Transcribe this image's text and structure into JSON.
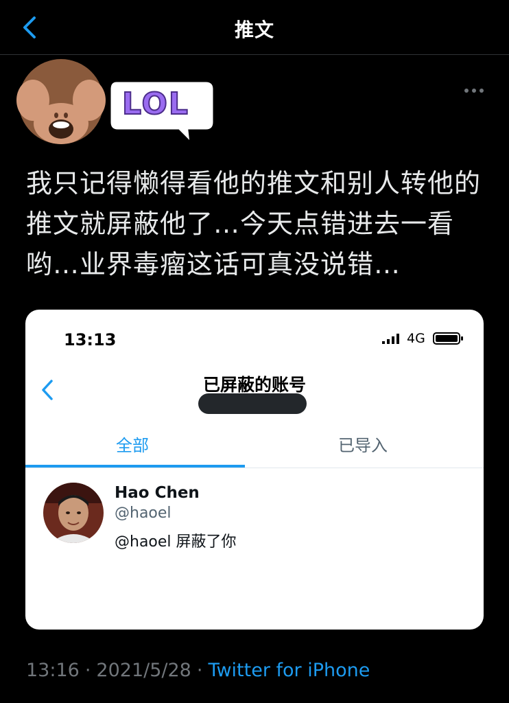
{
  "header": {
    "title": "推文"
  },
  "tweet": {
    "sticker_text": "LOL",
    "text": "我只记得懒得看他的推文和别人转他的推文就屏蔽他了…今天点错进去一看哟…业界毒瘤这话可真没说错…",
    "timestamp_time": "13:16",
    "timestamp_date": "2021/5/28",
    "separator": "·",
    "source": "Twitter for iPhone"
  },
  "embedded_screenshot": {
    "status_time": "13:13",
    "network": "4G",
    "title": "已屏蔽的账号",
    "tabs": [
      {
        "label": "全部",
        "active": true
      },
      {
        "label": "已导入",
        "active": false
      }
    ],
    "blocked_user": {
      "name": "Hao Chen",
      "handle": "@haoel",
      "status": "@haoel 屏蔽了你"
    }
  },
  "colors": {
    "background": "#000000",
    "accent": "#1d9bf0",
    "muted": "#71767b"
  }
}
